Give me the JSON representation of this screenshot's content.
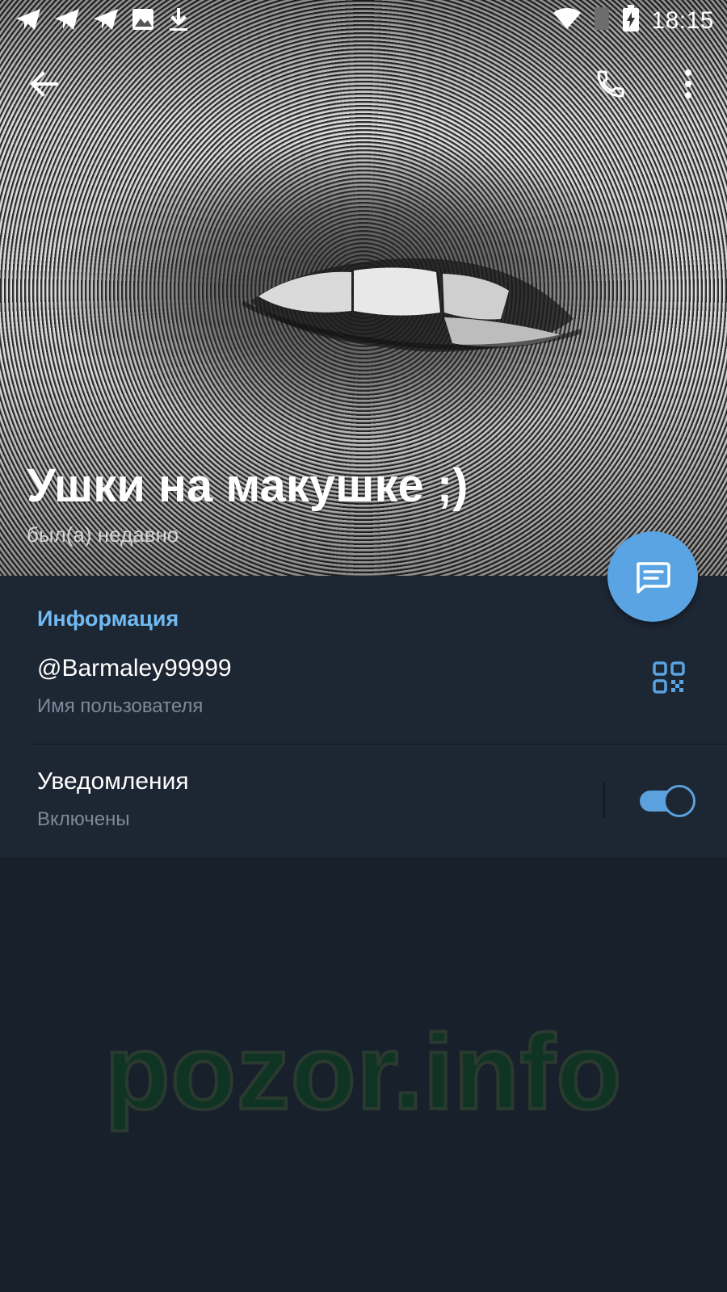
{
  "status_bar": {
    "time": "18:15",
    "left_icons": [
      "telegram-icon",
      "telegram-icon",
      "telegram-icon",
      "image-icon",
      "download-icon"
    ],
    "right_icons": [
      "wifi-icon",
      "signal-icon",
      "battery-charging-icon"
    ]
  },
  "app_bar": {
    "back_icon": "arrow-left-icon",
    "call_icon": "phone-icon",
    "menu_icon": "more-vertical-icon"
  },
  "profile": {
    "name": "Ушки на макушке ;)",
    "status": "был(а) недавно"
  },
  "info": {
    "section_title": "Информация",
    "username": "@Barmaley99999",
    "username_label": "Имя пользователя",
    "notifications_title": "Уведомления",
    "notifications_status": "Включены",
    "notifications_enabled": true
  },
  "fab": {
    "icon": "message-icon"
  },
  "watermark": "pozor.info",
  "colors": {
    "accent": "#5aa4e3",
    "section_title": "#71baf1",
    "panel_bg": "#1d2633",
    "page_bg": "#17202b"
  }
}
